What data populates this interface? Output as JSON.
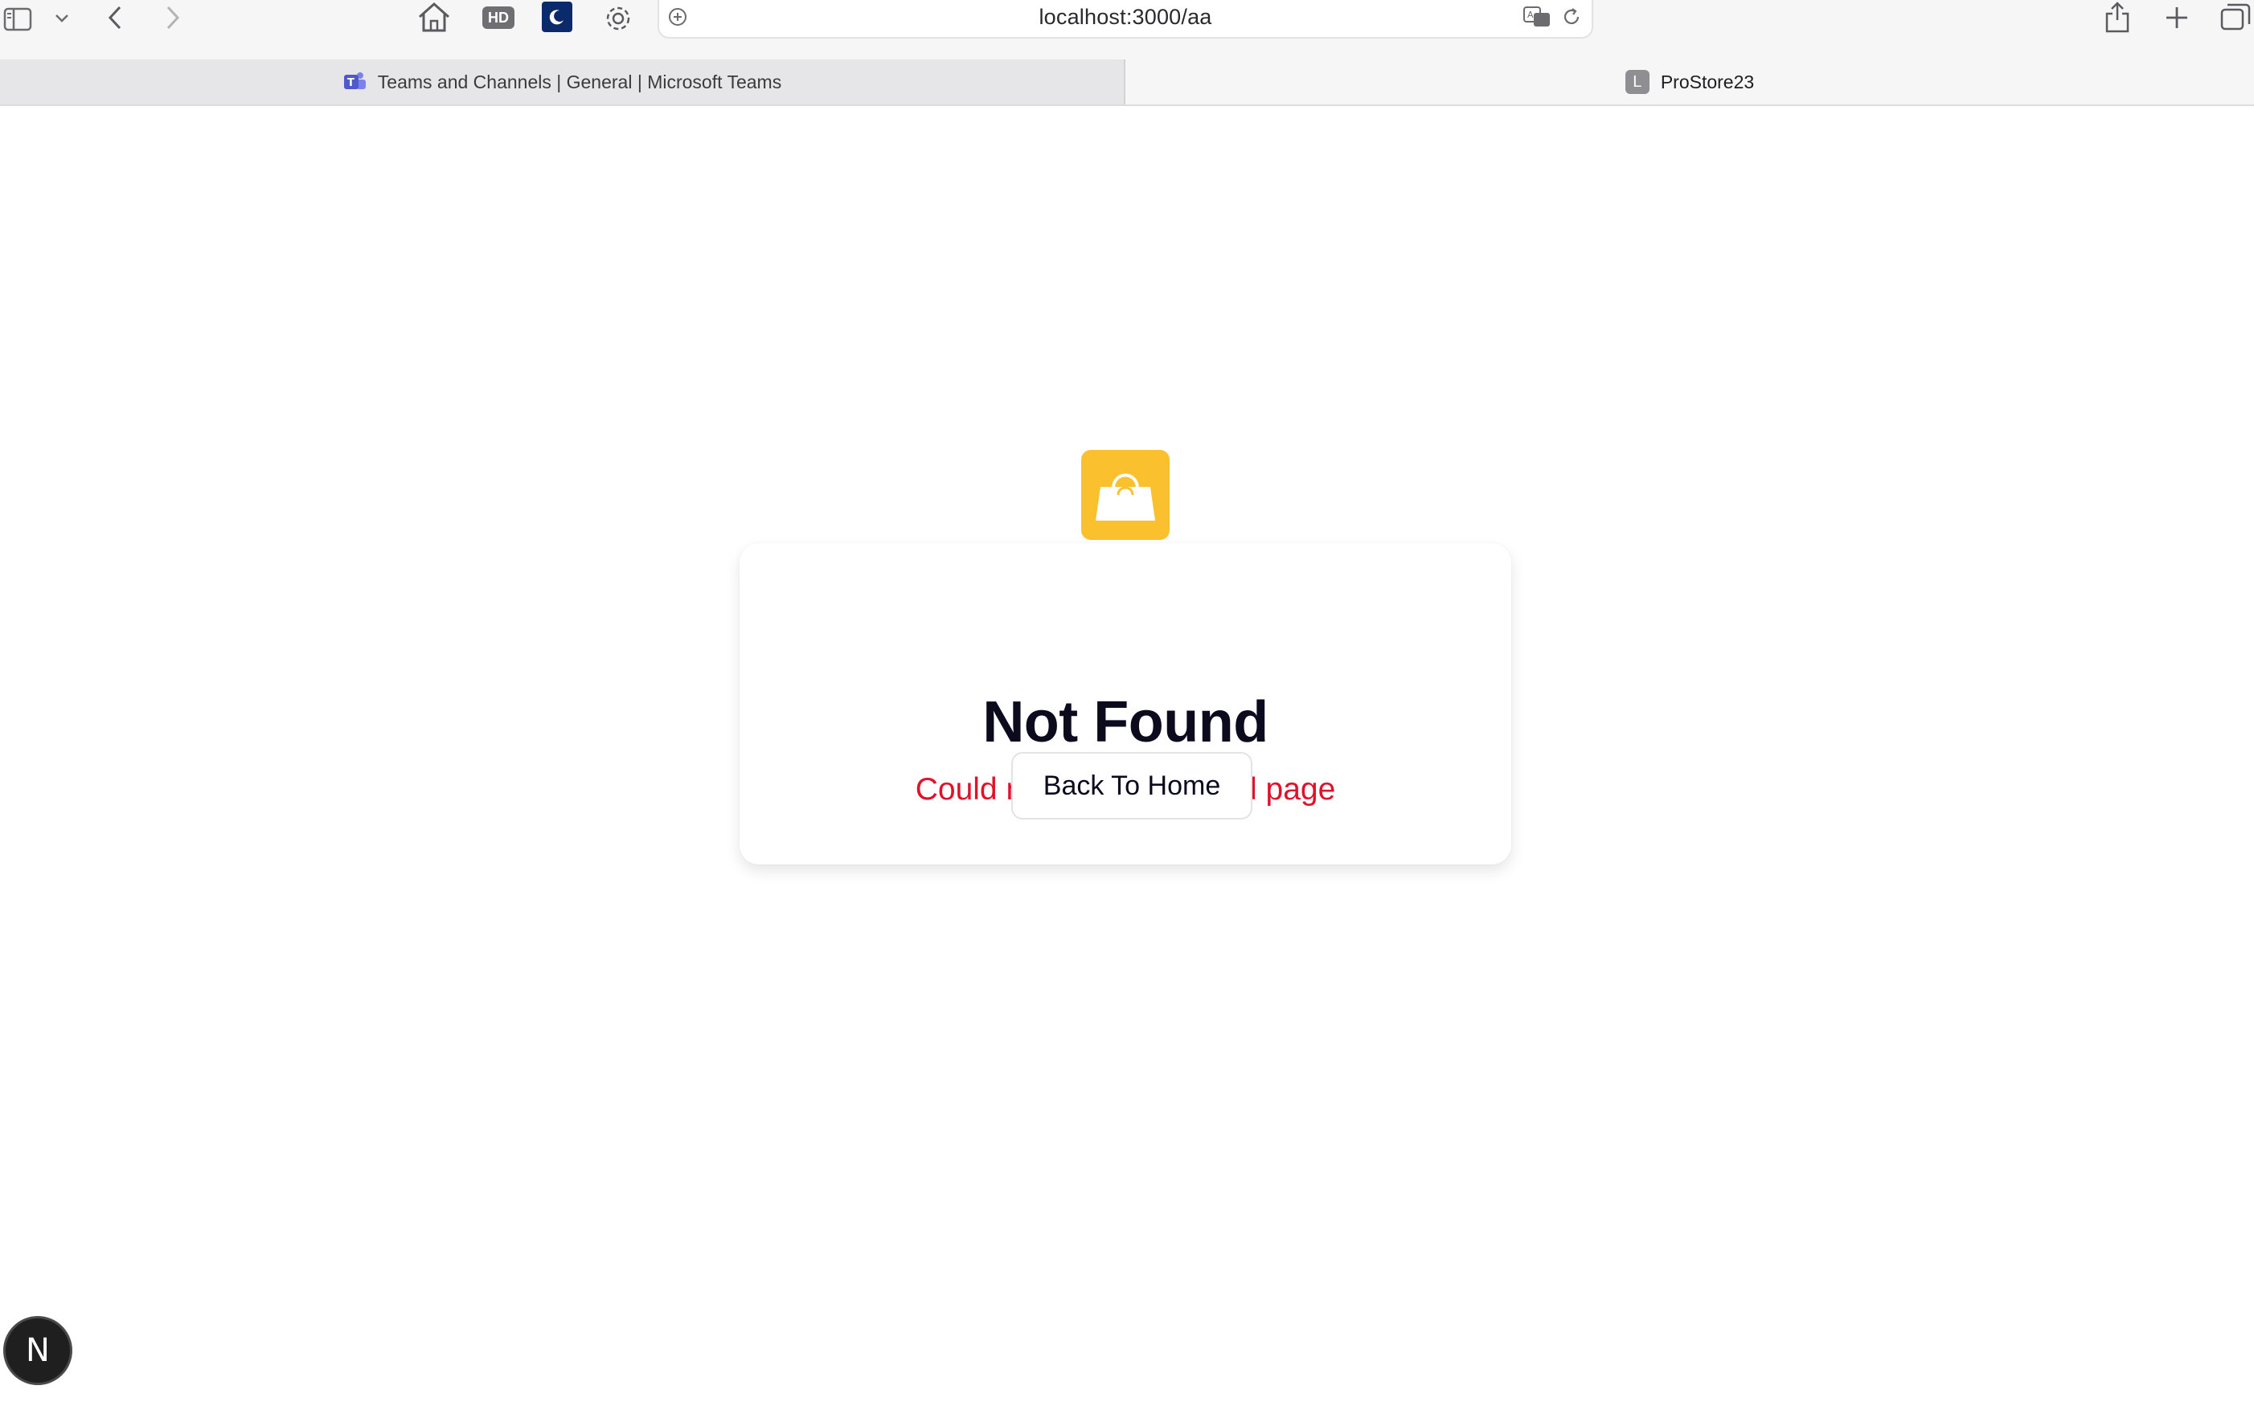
{
  "browser": {
    "url": "localhost:3000/aa",
    "toolbar_icons": [
      "sidebar-icon",
      "chevron-down-icon",
      "back-icon",
      "forward-icon",
      "home-icon",
      "hd-icon",
      "dark-mode-icon",
      "gear-icon",
      "page-icon",
      "translate-icon",
      "reload-icon",
      "share-icon",
      "plus-icon",
      "tabs-overview-icon"
    ],
    "hd_label": "HD",
    "tabs": [
      {
        "label": "Teams and Channels | General | Microsoft Teams",
        "active": false,
        "icon": "teams-icon"
      },
      {
        "label": "ProStore23",
        "active": true,
        "favicon_letter": "L"
      }
    ]
  },
  "page": {
    "logo_icon": "shopping-bag-icon",
    "logo_color": "#fbc02d",
    "title": "Not Found",
    "message": "Could not find requested page",
    "message_color": "#e0112b",
    "back_button_label": "Back To Home",
    "dev_badge_letter": "N"
  }
}
